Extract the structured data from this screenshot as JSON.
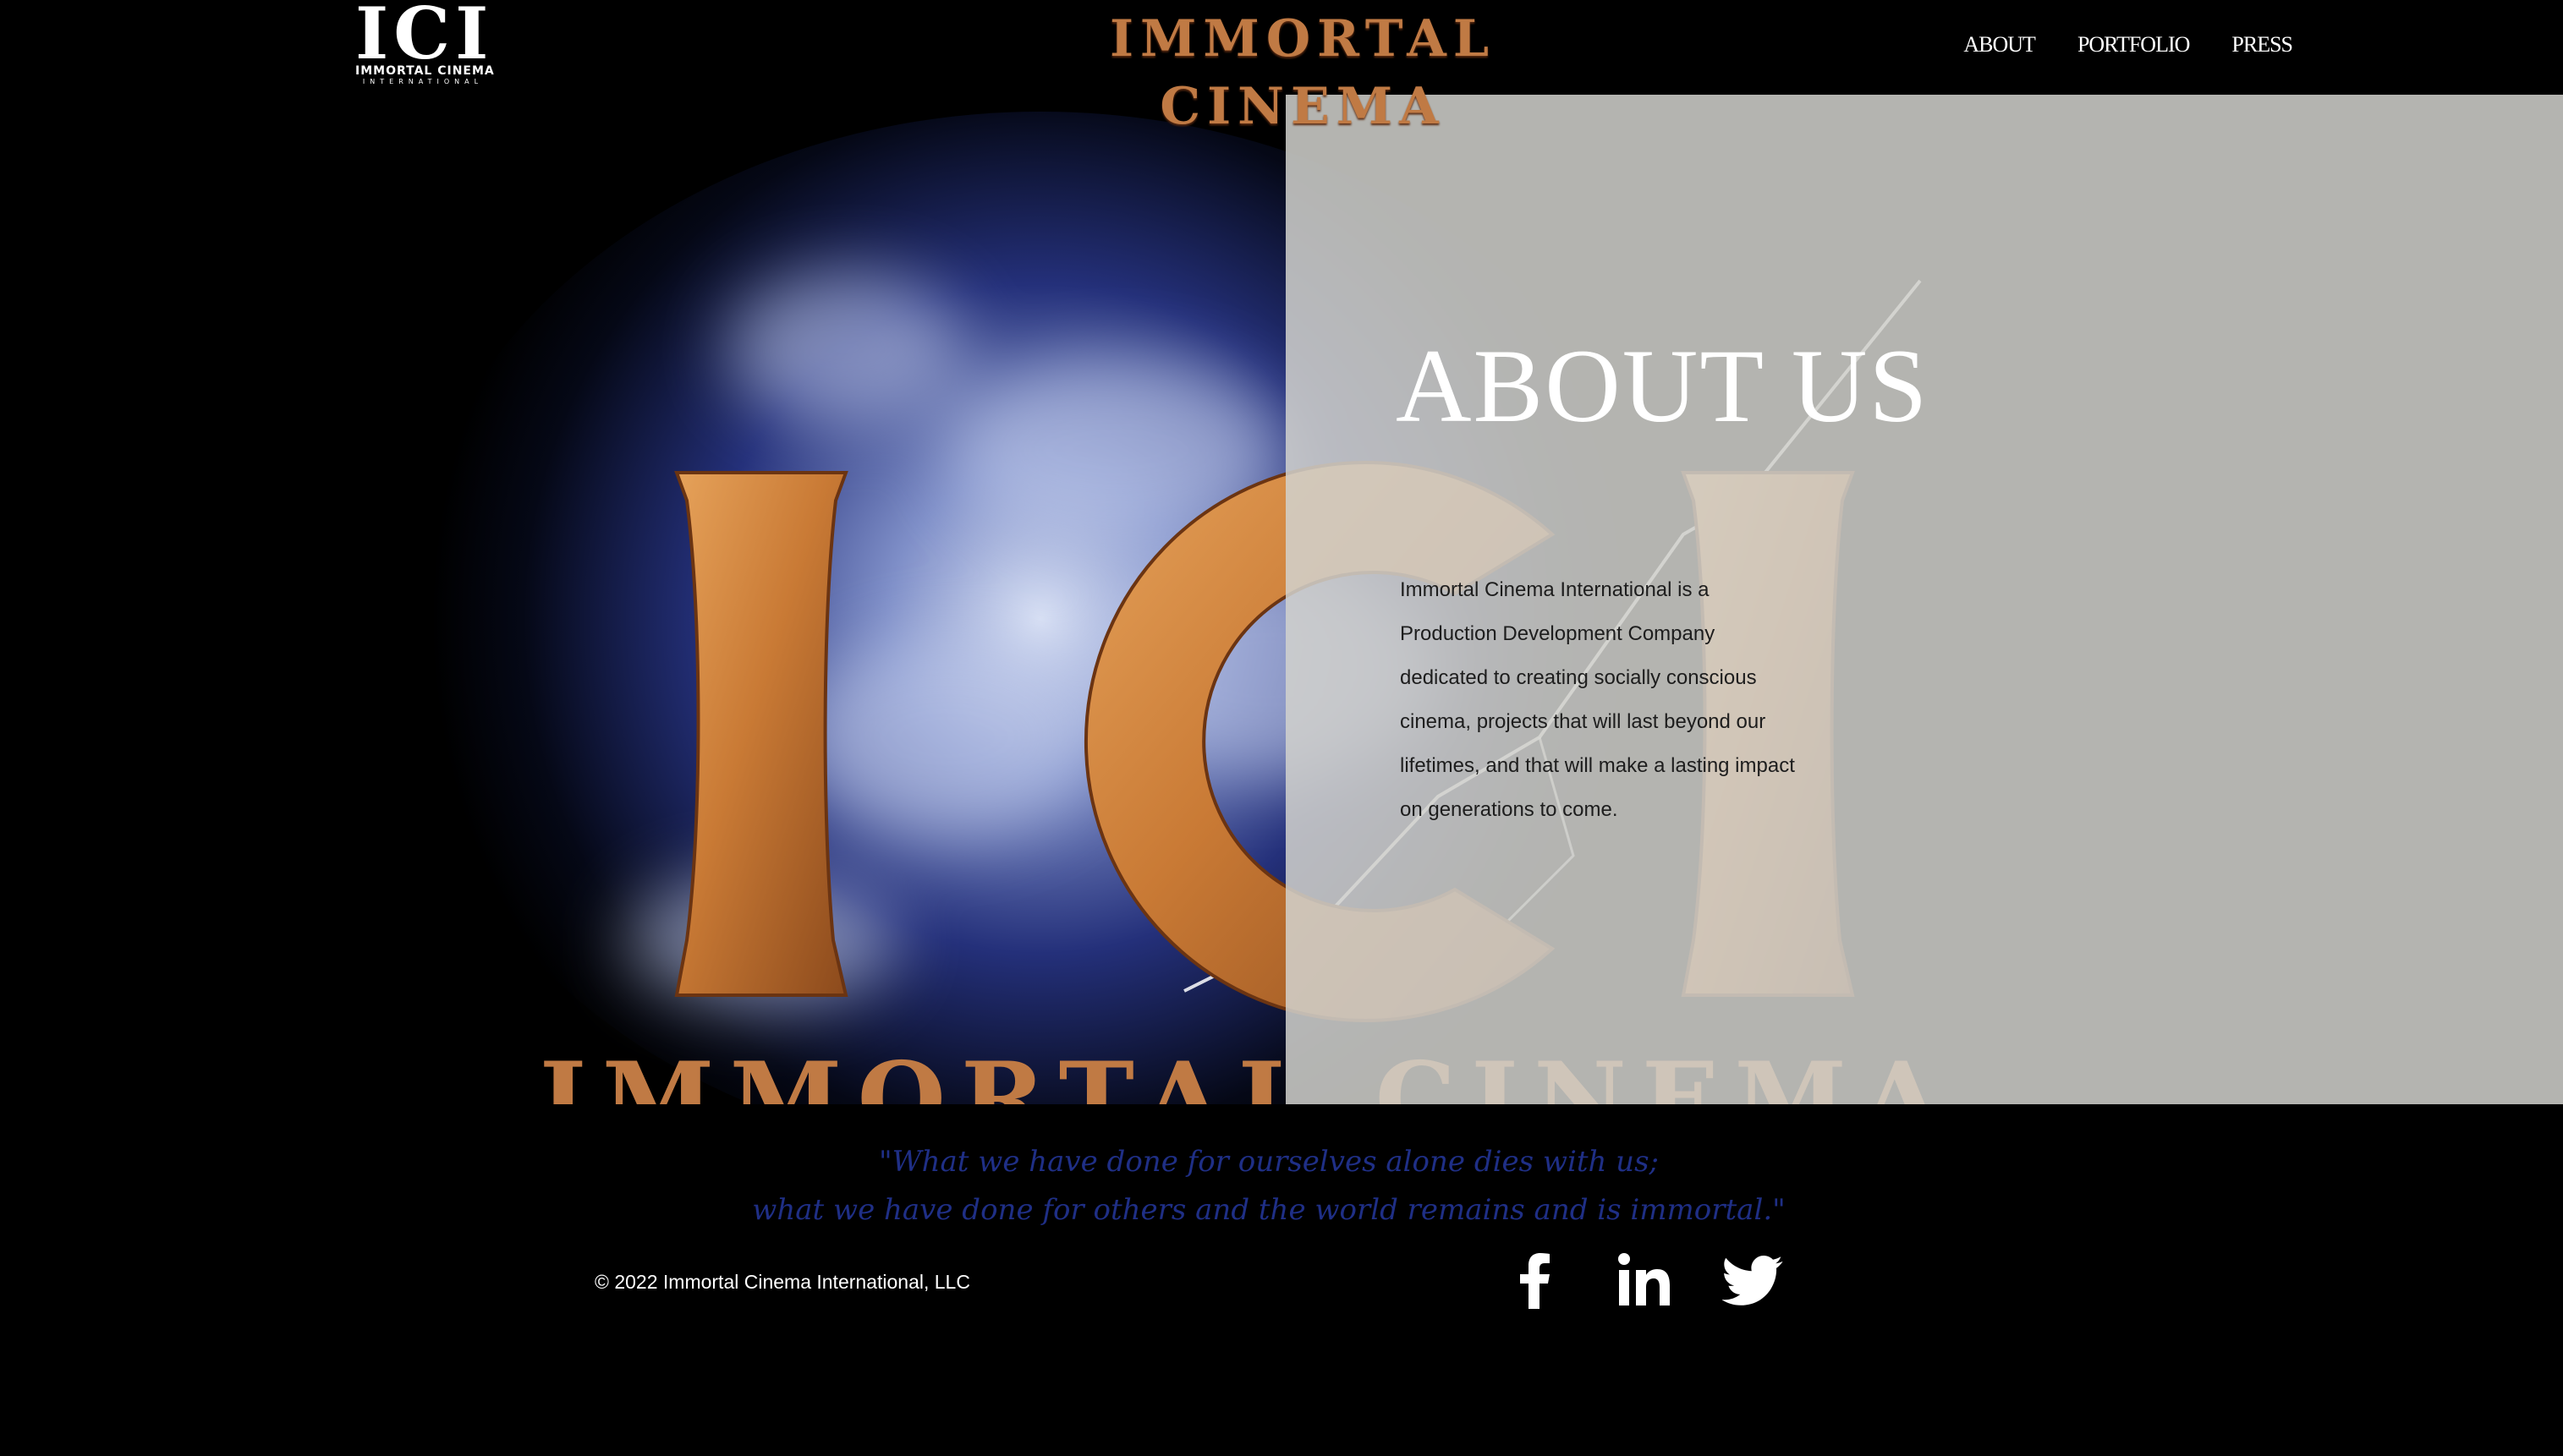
{
  "header": {
    "logo": {
      "mark": "ICI",
      "line1": "IMMORTAL CINEMA",
      "line2": "INTERNATIONAL"
    },
    "site_title": "IMMORTAL CINEMA",
    "nav": [
      "ABOUT",
      "PORTFOLIO",
      "PRESS"
    ]
  },
  "hero": {
    "art_text": {
      "letters": [
        "I",
        "C",
        "I"
      ],
      "banner": "IMMORTAL CINEMA"
    },
    "about_title": "ABOUT US",
    "about_body": "Immortal Cinema International is a Production Development Company dedicated to creating socially conscious cinema, projects that will last beyond our lifetimes, and that will make a lasting impact on generations to come."
  },
  "footer": {
    "quote_line1": "\"What we have done for ourselves alone dies with us;",
    "quote_line2": "what we have done for others and the world remains and is immortal.\"",
    "copyright": "© 2022 Immortal Cinema International, LLC",
    "social": [
      {
        "icon": "facebook-icon"
      },
      {
        "icon": "linkedin-icon"
      },
      {
        "icon": "twitter-icon"
      }
    ]
  },
  "colors": {
    "background": "#000000",
    "title_copper": "#c07a44",
    "overlay": "#d2d2cd",
    "quote_blue": "#1f2f86",
    "letter_gold": "#d18a43"
  }
}
